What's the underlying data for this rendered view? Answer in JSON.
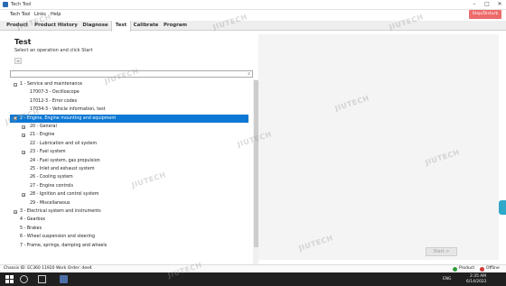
{
  "window": {
    "title": "Tech Tool",
    "minimize": "–",
    "maximize": "□",
    "close": "✕"
  },
  "menu": {
    "items": [
      "Tech Tool",
      "Links",
      "Help"
    ]
  },
  "stop_button": "Stop/Disturb",
  "tabs": [
    {
      "label": "Product",
      "active": false
    },
    {
      "label": "Product History",
      "active": false
    },
    {
      "label": "Diagnose",
      "active": false
    },
    {
      "label": "Test",
      "active": true
    },
    {
      "label": "Calibrate",
      "active": false
    },
    {
      "label": "Program",
      "active": false
    }
  ],
  "page": {
    "title": "Test",
    "subtitle": "Select an operation and click Start",
    "filter_icon": "filter-icon"
  },
  "search": {
    "value": "",
    "placeholder": ""
  },
  "tree": [
    {
      "label": "1 - Service and maintenance",
      "level": 0,
      "toggle": "−",
      "selected": false
    },
    {
      "label": "17007-3 - Oscilloscope",
      "level": 1,
      "toggle": "",
      "selected": false
    },
    {
      "label": "17012-3 - Error codes",
      "level": 1,
      "toggle": "",
      "selected": false
    },
    {
      "label": "17034-3 - Vehicle information, test",
      "level": 1,
      "toggle": "",
      "selected": false
    },
    {
      "label": "2 - Engine, Engine mounting and equipment",
      "level": 0,
      "toggle": "−",
      "selected": true
    },
    {
      "label": "20 - General",
      "level": 1,
      "toggle": "+",
      "selected": false
    },
    {
      "label": "21 - Engine",
      "level": 1,
      "toggle": "+",
      "selected": false
    },
    {
      "label": "22 - Lubrication and oil system",
      "level": 1,
      "toggle": "",
      "selected": false
    },
    {
      "label": "23 - Fuel system",
      "level": 1,
      "toggle": "+",
      "selected": false
    },
    {
      "label": "24 - Fuel system, gas propulsion",
      "level": 1,
      "toggle": "",
      "selected": false
    },
    {
      "label": "25 - Inlet and exhaust system",
      "level": 1,
      "toggle": "",
      "selected": false
    },
    {
      "label": "26 - Cooling system",
      "level": 1,
      "toggle": "",
      "selected": false
    },
    {
      "label": "27 - Engine controls",
      "level": 1,
      "toggle": "",
      "selected": false
    },
    {
      "label": "28 - Ignition and control system",
      "level": 1,
      "toggle": "+",
      "selected": false
    },
    {
      "label": "29 - Miscellaneous",
      "level": 1,
      "toggle": "",
      "selected": false
    },
    {
      "label": "3 - Electrical system and instruments",
      "level": 0,
      "toggle": "+",
      "selected": false
    },
    {
      "label": "4 - Gearbox",
      "level": 0,
      "toggle": "",
      "selected": false
    },
    {
      "label": "5 - Brakes",
      "level": 0,
      "toggle": "",
      "selected": false
    },
    {
      "label": "6 - Wheel suspension and steering",
      "level": 0,
      "toggle": "",
      "selected": false
    },
    {
      "label": "7 - Frame, springs, damping and wheels",
      "level": 0,
      "toggle": "",
      "selected": false
    }
  ],
  "start_button": "Start >",
  "status": {
    "chassis": "Chassis ID: EC360 11920",
    "work_order": "Work Order: dee4",
    "product": "Product",
    "offline": "Offline"
  },
  "taskbar": {
    "time": "2:35 AM",
    "date": "6/14/2022",
    "lang": "ENG"
  },
  "watermark": "JIUTECH",
  "colors": {
    "selected": "#0a78d4",
    "stop": "#ee6b6b",
    "online": "#2e9e3a",
    "offline": "#d23b3b"
  }
}
